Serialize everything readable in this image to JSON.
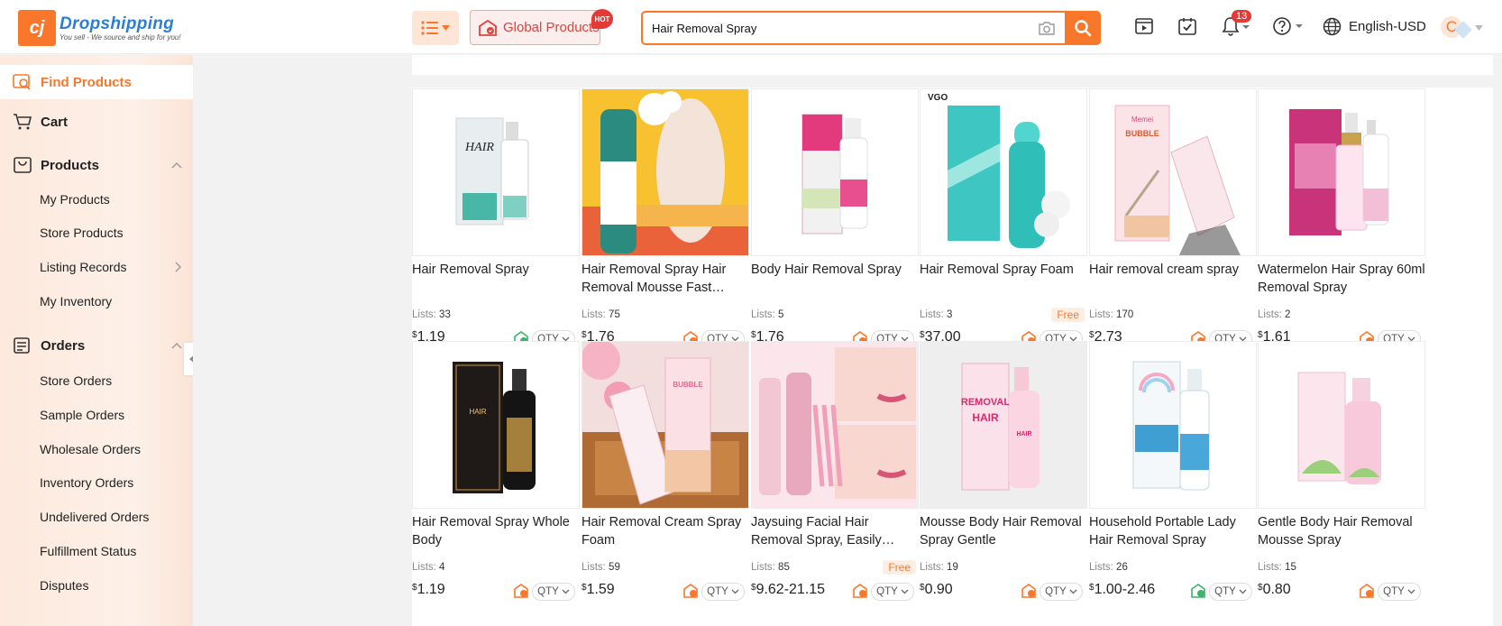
{
  "header": {
    "logo_title": "Dropshipping",
    "logo_sub": "You sell - We source and ship for you!",
    "global_products": "Global Products",
    "hot_badge": "HOT",
    "search_value": "Hair Removal Spray",
    "notification_count": "13",
    "language": "English-USD",
    "avatar_letter": "C"
  },
  "sidebar": {
    "find_products": "Find Products",
    "cart": "Cart",
    "products": "Products",
    "my_products": "My Products",
    "store_products": "Store Products",
    "listing_records": "Listing Records",
    "my_inventory": "My Inventory",
    "orders": "Orders",
    "store_orders": "Store Orders",
    "sample_orders": "Sample Orders",
    "wholesale_orders": "Wholesale Orders",
    "inventory_orders": "Inventory Orders",
    "undelivered_orders": "Undelivered Orders",
    "fulfillment_status": "Fulfillment Status",
    "disputes": "Disputes"
  },
  "labels": {
    "lists": "Lists:",
    "qty": "QTY",
    "currency": "$",
    "free": "Free"
  },
  "products": [
    {
      "title": "Hair Removal Spray",
      "lists": "33",
      "price": "1.19",
      "free": false,
      "stock": "green",
      "img": "ouhoe-white"
    },
    {
      "title": "Hair Removal Spray Hair Removal Mousse Fast Hair…",
      "lists": "75",
      "price": "1.76",
      "free": false,
      "stock": "orange",
      "img": "foam-yellow"
    },
    {
      "title": "Body Hair Removal Spray",
      "lists": "5",
      "price": "1.76",
      "free": false,
      "stock": "orange",
      "img": "pink-box"
    },
    {
      "title": "Hair Removal Spray Foam",
      "lists": "3",
      "price": "37.00",
      "free": true,
      "stock": "orange",
      "img": "teal-can"
    },
    {
      "title": "Hair removal cream spray",
      "lists": "170",
      "price": "2.73",
      "free": false,
      "stock": "orange",
      "img": "bubble-pink"
    },
    {
      "title": "Watermelon Hair Spray 60ml Removal Spray",
      "lists": "2",
      "price": "1.61",
      "free": false,
      "stock": "orange",
      "img": "pink-bottle"
    },
    {
      "title": "Hair Removal Spray Whole Body",
      "lists": "4",
      "price": "1.19",
      "free": false,
      "stock": "orange",
      "img": "black-gold"
    },
    {
      "title": "Hair Removal Cream Spray Foam",
      "lists": "59",
      "price": "1.59",
      "free": false,
      "stock": "orange",
      "img": "bubble-wood"
    },
    {
      "title": "Jaysuing Facial Hair Removal Spray, Easily…",
      "lists": "85",
      "price": "9.62-21.15",
      "free": true,
      "stock": "orange",
      "img": "face-pink"
    },
    {
      "title": "Mousse Body Hair Removal Spray Gentle",
      "lists": "19",
      "price": "0.90",
      "free": false,
      "stock": "orange",
      "img": "removal-hair"
    },
    {
      "title": "Household Portable Lady Hair Removal Spray",
      "lists": "26",
      "price": "1.00-2.46",
      "free": false,
      "stock": "green",
      "img": "rainbow-blue"
    },
    {
      "title": "Gentle Body Hair Removal Mousse Spray",
      "lists": "15",
      "price": "0.80",
      "free": false,
      "stock": "orange",
      "img": "gentle-pink"
    }
  ]
}
